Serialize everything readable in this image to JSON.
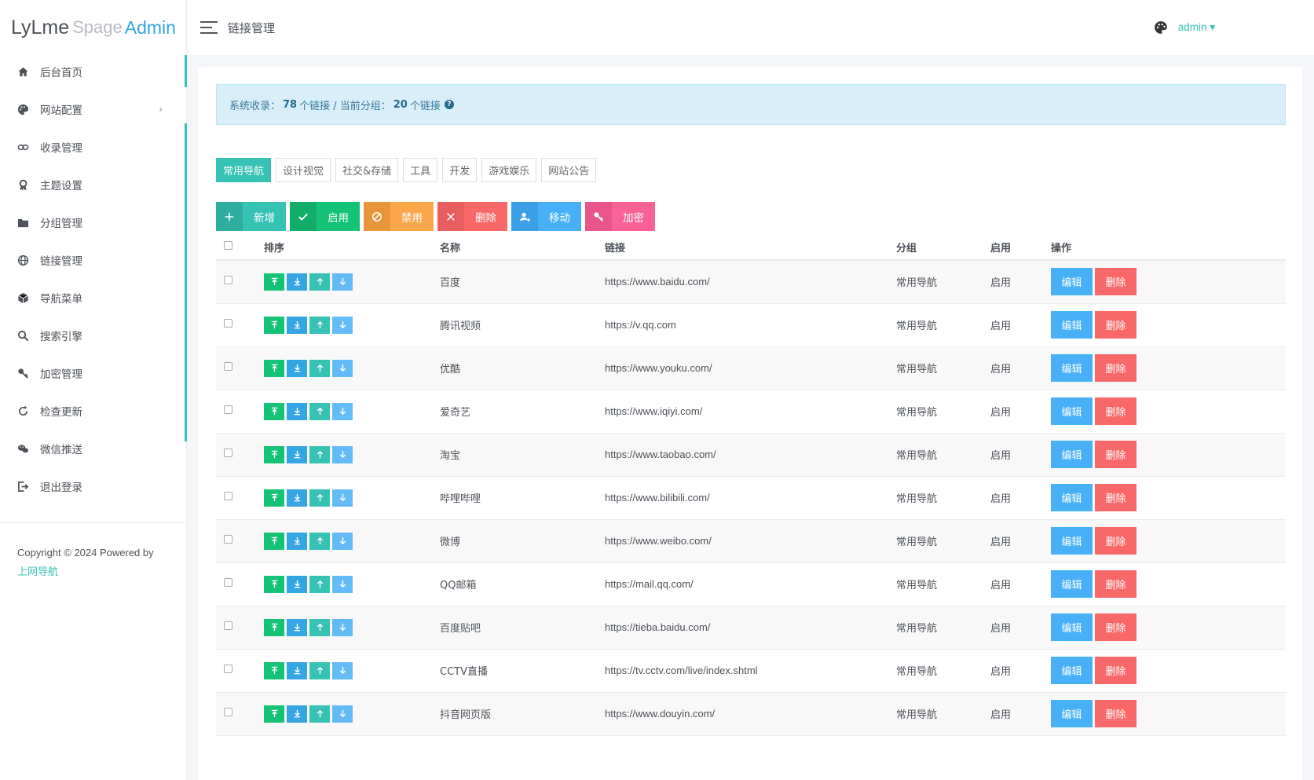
{
  "logo": {
    "part1": "LyLme",
    "part2": "Spage",
    "part3": "Admin"
  },
  "sidebar": {
    "items": [
      {
        "label": "后台首页",
        "icon": "home-icon"
      },
      {
        "label": "网站配置",
        "icon": "palette-icon",
        "chevron": "›"
      },
      {
        "label": "收录管理",
        "icon": "link-icon"
      },
      {
        "label": "主题设置",
        "icon": "award-icon"
      },
      {
        "label": "分组管理",
        "icon": "folder-icon"
      },
      {
        "label": "链接管理",
        "icon": "globe-icon"
      },
      {
        "label": "导航菜单",
        "icon": "cube-icon"
      },
      {
        "label": "搜索引擎",
        "icon": "search-icon"
      },
      {
        "label": "加密管理",
        "icon": "key-icon"
      },
      {
        "label": "检查更新",
        "icon": "refresh-icon"
      },
      {
        "label": "微信推送",
        "icon": "wechat-icon"
      },
      {
        "label": "退出登录",
        "icon": "logout-icon"
      }
    ],
    "copyright": "Copyright © 2024 Powered by",
    "copyright_link": "上网导航"
  },
  "topbar": {
    "page_title": "链接管理",
    "user": "admin ▾"
  },
  "alert": {
    "prefix": "系统收录：",
    "total": "78",
    "total_suffix": "个链接 / 当前分组：",
    "group_count": "20",
    "group_suffix": "个链接",
    "help": "?"
  },
  "tabs": [
    "常用导航",
    "设计视觉",
    "社交&存储",
    "工具",
    "开发",
    "游戏娱乐",
    "网站公告"
  ],
  "toolbar": [
    {
      "label": "新增",
      "icon": "plus-icon",
      "color": "#36c2b4"
    },
    {
      "label": "启用",
      "icon": "check-icon",
      "color": "#15c377"
    },
    {
      "label": "禁用",
      "icon": "ban-icon",
      "color": "#faa64b"
    },
    {
      "label": "删除",
      "icon": "close-icon",
      "color": "#f96868"
    },
    {
      "label": "移动",
      "icon": "user-move-icon",
      "color": "#48b0f7"
    },
    {
      "label": "加密",
      "icon": "key-icon",
      "color": "#f96197"
    }
  ],
  "table": {
    "headers": [
      "排序",
      "名称",
      "链接",
      "分组",
      "启用",
      "操作"
    ],
    "edit_label": "编辑",
    "delete_label": "删除",
    "rows": [
      {
        "name": "百度",
        "url": "https://www.baidu.com/",
        "group": "常用导航",
        "status": "启用"
      },
      {
        "name": "腾讯视频",
        "url": "https://v.qq.com",
        "group": "常用导航",
        "status": "启用"
      },
      {
        "name": "优酷",
        "url": "https://www.youku.com/",
        "group": "常用导航",
        "status": "启用"
      },
      {
        "name": "爱奇艺",
        "url": "https://www.iqiyi.com/",
        "group": "常用导航",
        "status": "启用"
      },
      {
        "name": "淘宝",
        "url": "https://www.taobao.com/",
        "group": "常用导航",
        "status": "启用"
      },
      {
        "name": "哔哩哔哩",
        "url": "https://www.bilibili.com/",
        "group": "常用导航",
        "status": "启用"
      },
      {
        "name": "微博",
        "url": "https://www.weibo.com/",
        "group": "常用导航",
        "status": "启用"
      },
      {
        "name": "QQ邮箱",
        "url": "https://mail.qq.com/",
        "group": "常用导航",
        "status": "启用"
      },
      {
        "name": "百度贴吧",
        "url": "https://tieba.baidu.com/",
        "group": "常用导航",
        "status": "启用"
      },
      {
        "name": "CCTV直播",
        "url": "https://tv.cctv.com/live/index.shtml",
        "group": "常用导航",
        "status": "启用"
      },
      {
        "name": "抖音网页版",
        "url": "https://www.douyin.com/",
        "group": "常用导航",
        "status": "启用"
      }
    ]
  }
}
